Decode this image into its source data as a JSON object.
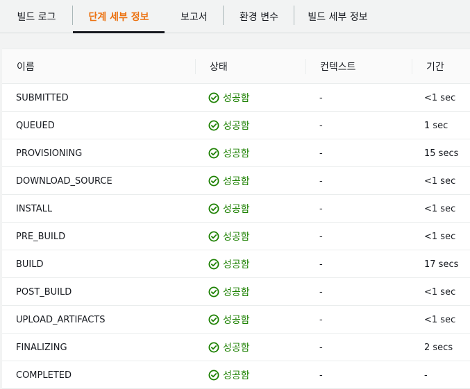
{
  "tabs": [
    {
      "label": "빌드 로그"
    },
    {
      "label": "단계 세부 정보"
    },
    {
      "label": "보고서"
    },
    {
      "label": "환경 변수"
    },
    {
      "label": "빌드 세부 정보"
    }
  ],
  "active_tab": "단계 세부 정보",
  "table": {
    "columns": [
      "이름",
      "상태",
      "컨텍스트",
      "기간"
    ],
    "rows": [
      {
        "name": "SUBMITTED",
        "status": "성공함",
        "context": "-",
        "duration": "<1 sec"
      },
      {
        "name": "QUEUED",
        "status": "성공함",
        "context": "-",
        "duration": "1 sec"
      },
      {
        "name": "PROVISIONING",
        "status": "성공함",
        "context": "-",
        "duration": "15 secs"
      },
      {
        "name": "DOWNLOAD_SOURCE",
        "status": "성공함",
        "context": "-",
        "duration": "<1 sec"
      },
      {
        "name": "INSTALL",
        "status": "성공함",
        "context": "-",
        "duration": "<1 sec"
      },
      {
        "name": "PRE_BUILD",
        "status": "성공함",
        "context": "-",
        "duration": "<1 sec"
      },
      {
        "name": "BUILD",
        "status": "성공함",
        "context": "-",
        "duration": "17 secs"
      },
      {
        "name": "POST_BUILD",
        "status": "성공함",
        "context": "-",
        "duration": "<1 sec"
      },
      {
        "name": "UPLOAD_ARTIFACTS",
        "status": "성공함",
        "context": "-",
        "duration": "<1 sec"
      },
      {
        "name": "FINALIZING",
        "status": "성공함",
        "context": "-",
        "duration": "2 secs"
      },
      {
        "name": "COMPLETED",
        "status": "성공함",
        "context": "-",
        "duration": "-"
      }
    ]
  },
  "icons": {
    "status": "check-circle-icon"
  },
  "colors": {
    "active_tab": "#ec7211",
    "success": "#1d8102"
  }
}
